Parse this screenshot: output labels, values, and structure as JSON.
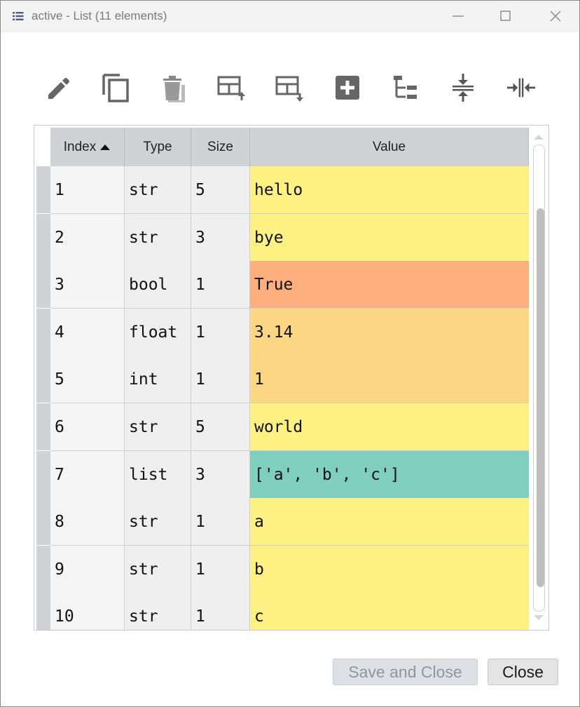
{
  "window": {
    "title": "active - List (11 elements)",
    "controls": [
      "minimize-icon",
      "maximize-icon",
      "close-icon"
    ]
  },
  "toolbar": {
    "buttons": [
      {
        "name": "edit-icon"
      },
      {
        "name": "copy-icon"
      },
      {
        "name": "delete-icon"
      },
      {
        "name": "insert-above-icon"
      },
      {
        "name": "insert-below-icon"
      },
      {
        "name": "append-icon"
      },
      {
        "name": "tree-view-icon"
      },
      {
        "name": "collapse-icon"
      },
      {
        "name": "expand-icon"
      }
    ]
  },
  "table": {
    "headers": {
      "index": "Index",
      "type": "Type",
      "size": "Size",
      "value": "Value"
    },
    "sort_column": "Index",
    "sort_direction": "ascending",
    "rows": [
      {
        "index": "1",
        "type": "str",
        "size": "5",
        "value": "hello",
        "color": "#fef183"
      },
      {
        "index": "2",
        "type": "str",
        "size": "3",
        "value": "bye",
        "color": "#fef183"
      },
      {
        "index": "3",
        "type": "bool",
        "size": "1",
        "value": "True",
        "color": "#feb07c"
      },
      {
        "index": "4",
        "type": "float",
        "size": "1",
        "value": "3.14",
        "color": "#fdd684"
      },
      {
        "index": "5",
        "type": "int",
        "size": "1",
        "value": "1",
        "color": "#fdd684"
      },
      {
        "index": "6",
        "type": "str",
        "size": "5",
        "value": "world",
        "color": "#fef183"
      },
      {
        "index": "7",
        "type": "list",
        "size": "3",
        "value": "['a', 'b', 'c']",
        "color": "#7ecfbf"
      },
      {
        "index": "8",
        "type": "str",
        "size": "1",
        "value": "a",
        "color": "#fef183"
      },
      {
        "index": "9",
        "type": "str",
        "size": "1",
        "value": "b",
        "color": "#fef183"
      },
      {
        "index": "10",
        "type": "str",
        "size": "1",
        "value": "c",
        "color": "#fef183"
      }
    ]
  },
  "buttons": {
    "save_and_close": "Save and Close",
    "close": "Close"
  }
}
